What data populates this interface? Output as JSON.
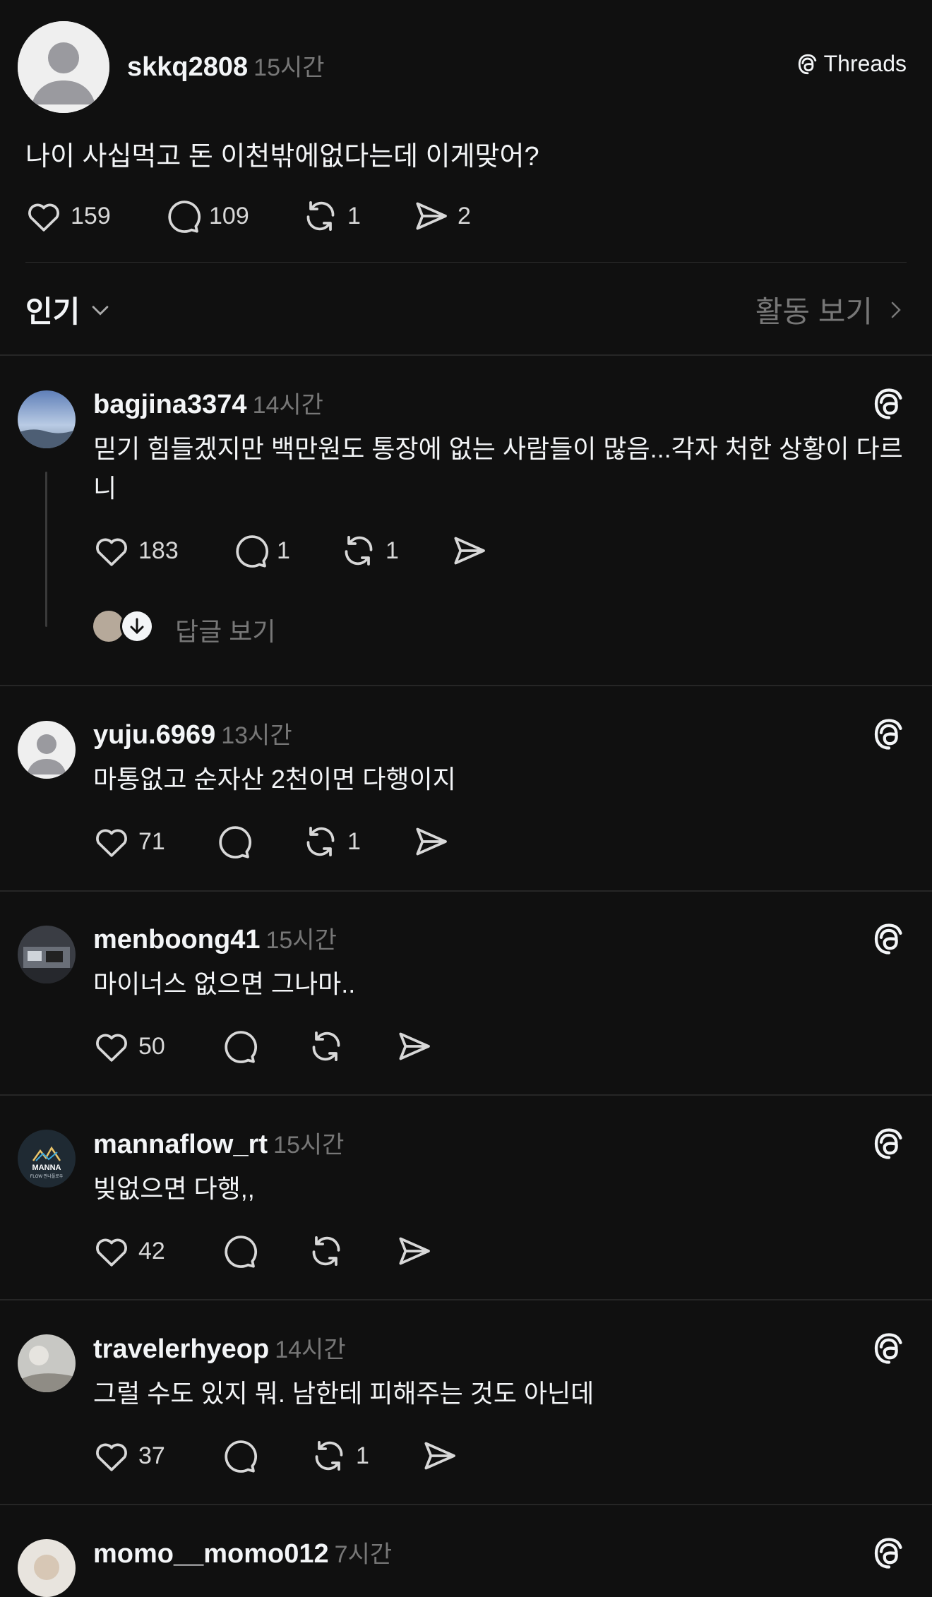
{
  "post": {
    "username": "skkq2808",
    "time": "15시간",
    "badge": "Threads",
    "text": "나이 사십먹고 돈 이천밖에없다는데 이게맞어?",
    "likes": "159",
    "comments": "109",
    "reposts": "1",
    "shares": "2"
  },
  "sort": {
    "label": "인기",
    "activity": "활동 보기"
  },
  "comments": [
    {
      "username": "bagjina3374",
      "time": "14시간",
      "text": "믿기 힘들겠지만 백만원도 통장에 없는 사람들이 많음...각자 처한 상황이 다르니",
      "likes": "183",
      "comments": "1",
      "reposts": "1",
      "view_replies": "답글 보기"
    },
    {
      "username": "yuju.6969",
      "time": "13시간",
      "text": "마통없고 순자산 2천이면 다행이지",
      "likes": "71",
      "comments": "",
      "reposts": "1"
    },
    {
      "username": "menboong41",
      "time": "15시간",
      "text": "마이너스 없으면 그나마..",
      "likes": "50",
      "comments": "",
      "reposts": ""
    },
    {
      "username": "mannaflow_rt",
      "time": "15시간",
      "text": "빚없으면 다행,,",
      "likes": "42",
      "comments": "",
      "reposts": "",
      "avatar_text": "MANNA",
      "avatar_subtext": "FLOW 만나플로우"
    },
    {
      "username": "travelerhyeop",
      "time": "14시간",
      "text": "그럴 수도 있지 뭐. 남한테 피해주는 것도 아닌데",
      "likes": "37",
      "comments": "",
      "reposts": "1"
    },
    {
      "username": "momo__momo012",
      "time": "7시간"
    }
  ],
  "icons": {
    "like": "heart-icon",
    "comment": "comment-icon",
    "repost": "repost-icon",
    "share": "send-icon",
    "threads": "threads-logo-icon",
    "chevron_down": "chevron-down-icon",
    "chevron_right": "chevron-right-icon"
  }
}
